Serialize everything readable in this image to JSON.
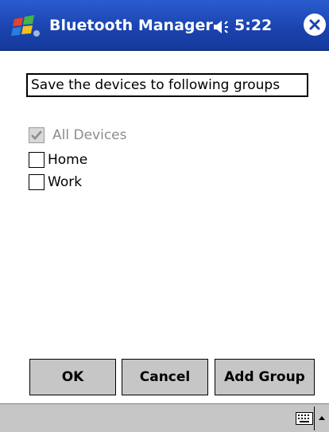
{
  "title_bar": {
    "app_title": "Bluetooth Manager",
    "time": "5:22",
    "icons": [
      "windows-start-icon",
      "speaker-icon",
      "close-icon"
    ],
    "colors": {
      "background": "#1b44b0",
      "text": "#ffffff"
    }
  },
  "main": {
    "caption": "Save the devices to following groups",
    "groups": [
      {
        "label": "All Devices",
        "checked": true,
        "disabled": true
      },
      {
        "label": "Home",
        "checked": false,
        "disabled": false
      },
      {
        "label": "Work",
        "checked": false,
        "disabled": false
      }
    ]
  },
  "buttons": {
    "ok": "OK",
    "cancel": "Cancel",
    "add_group": "Add Group"
  },
  "menu_bar": {
    "icons": [
      "keyboard-icon",
      "up-arrow-icon"
    ],
    "colors": {
      "background": "#c6c6c6"
    }
  }
}
